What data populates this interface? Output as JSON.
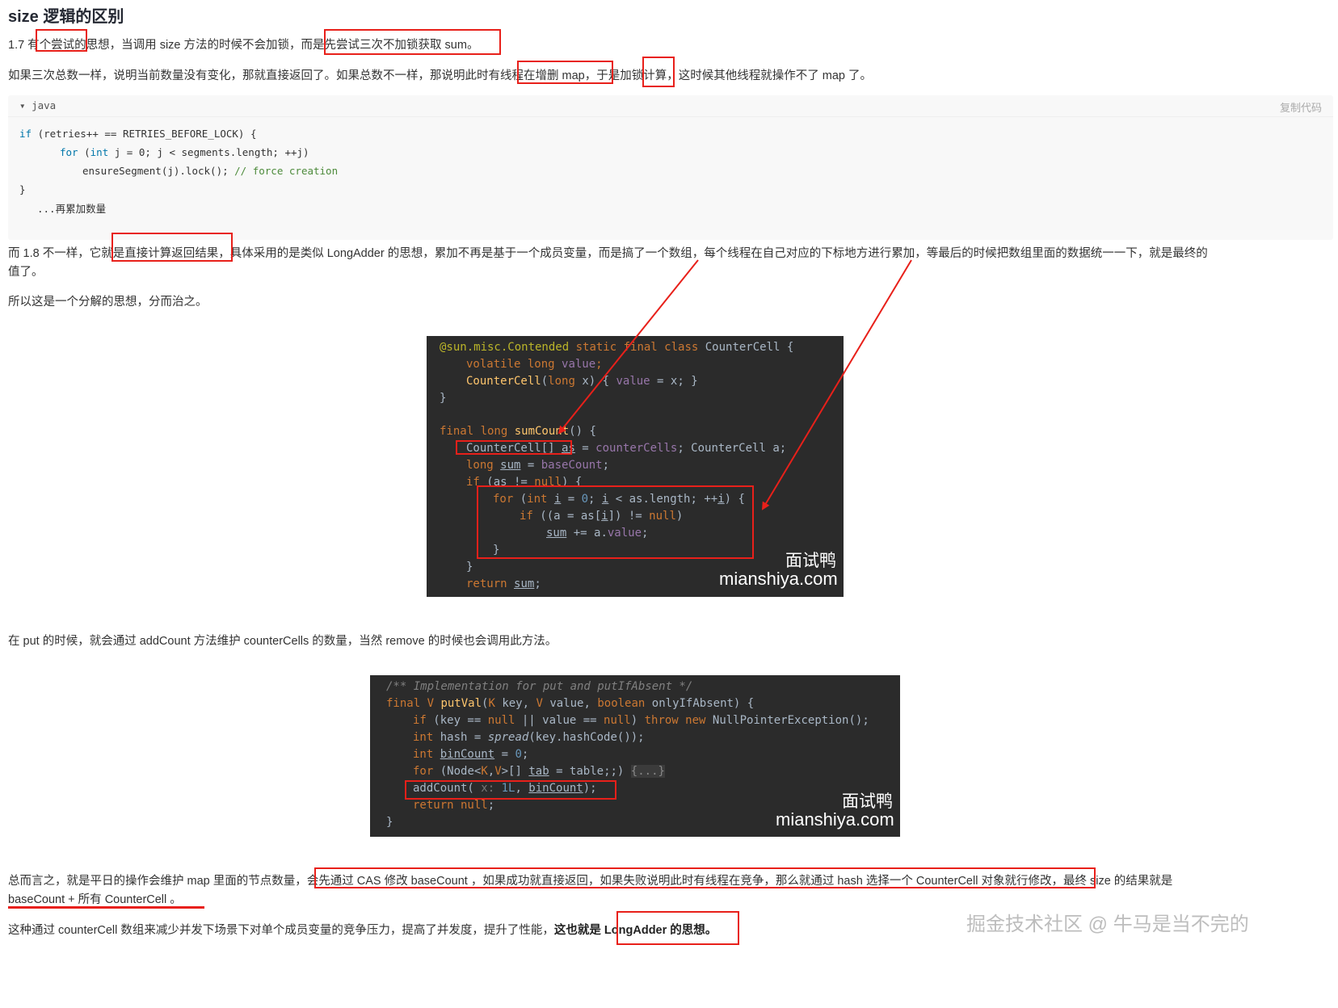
{
  "heading": "size 逻辑的区别",
  "p1": {
    "pre": "1.7 有",
    "hl1": "个尝试的",
    "mid": "思想，当调用 size 方法的时候不会加锁，而",
    "hl2": "是先尝试三次不加锁获取 sum。"
  },
  "p2": {
    "pre": "如果三次总数一样，说明当前数量没有变化，那就直接返回了。如果总数不一样，那说明此时有",
    "hl1": "线程在增删 map",
    "mid": "，于是",
    "hl2": "加锁",
    "post": "计算，这时候其他线程就操作不了 map 了。"
  },
  "code1": {
    "lang": "java",
    "copy_label": "复制代码",
    "line1_kw": "if",
    "line1_rest": " (retries++ == RETRIES_BEFORE_LOCK) {",
    "line2_kw1": "for",
    "line2_p1": " (",
    "line2_kw2": "int",
    "line2_rest": " j = 0; j < segments.length; ++j)",
    "line3_code": "ensureSegment(j).lock(); ",
    "line3_comment": "// force creation",
    "line4": "}",
    "line5": "...再累加数量"
  },
  "p3": {
    "pre": "而 1.8 不一样，它就",
    "hl": "是直接计算返回结果",
    "post": "，具体采用的是类似 LongAdder 的思想，累加不再是基于一个成员变量，而是搞了一个数组，每个线程在自己对应的下标地方进行累加，等最后的时候把数组里面的数据统一一下，就是最终的",
    "post2": "值了。"
  },
  "p4": "所以这是一个分解的思想，分而治之。",
  "img1": {
    "l1_ann": "@sun.misc.Contended",
    "l1_k": " static final class ",
    "l1_name": "CounterCell",
    "l1_b": " {",
    "l2_k": "volatile long ",
    "l2_v": "value",
    "l2_s": ";",
    "l3_f": "CounterCell",
    "l3_a": "(",
    "l3_k": "long ",
    "l3_b": "x) { ",
    "l3_v": "value",
    "l3_c": " = x; }",
    "l4": "}",
    "l5_k": "final long ",
    "l5_f": "sumCount",
    "l5_b": "() {",
    "l6_a": "CounterCell[] ",
    "l6_u": "as",
    "l6_b": " = ",
    "l6_v": "counterCells",
    "l6_c": "; CounterCell a;",
    "l7_k": "long ",
    "l7_u": "sum",
    "l7_b": " = ",
    "l7_v": "baseCount",
    "l7_c": ";",
    "l8_k": "if",
    "l8_b": " (",
    "l8_u": "as",
    "l8_c": " != ",
    "l8_k2": "null",
    "l8_d": ") {",
    "l9_k": "for",
    "l9_b": " (",
    "l9_k2": "int ",
    "l9_u": "i",
    "l9_c": " = ",
    "l9_n": "0",
    "l9_d": "; ",
    "l9_u2": "i",
    "l9_e": " < as.length; ++",
    "l9_u3": "i",
    "l9_f": ") {",
    "l10_k": "if",
    "l10_b": " ((a = as[",
    "l10_u": "i",
    "l10_c": "]) != ",
    "l10_k2": "null",
    "l10_d": ")",
    "l11_u": "sum",
    "l11_b": " += a.",
    "l11_v": "value",
    "l11_c": ";",
    "l12": "}",
    "l13": "}",
    "l14_k": "return ",
    "l14_u": "sum",
    "l14_b": ";",
    "wm1": "面试鸭",
    "wm2": "mianshiya.com"
  },
  "p5": "在 put 的时候，就会通过 addCount 方法维护 counterCells 的数量，当然 remove 的时候也会调用此方法。",
  "img2": {
    "l1": "/** Implementation for put and putIfAbsent */",
    "l2_k": "final ",
    "l2_g": "V ",
    "l2_f": "putVal",
    "l2_a": "(",
    "l2_g2": "K ",
    "l2_b": "key, ",
    "l2_g3": "V ",
    "l2_c": "value, ",
    "l2_k2": "boolean ",
    "l2_d": "onlyIfAbsent) {",
    "l3_k": "if",
    "l3_b": " (key == ",
    "l3_k2": "null",
    "l3_c": " || value == ",
    "l3_k3": "null",
    "l3_d": ") ",
    "l3_k4": "throw new ",
    "l3_e": "NullPointerException();",
    "l4_k": "int ",
    "l4_b": "hash = ",
    "l4_f": "spread",
    "l4_c": "(key.hashCode());",
    "l5_k": "int ",
    "l5_u": "binCount",
    "l5_b": " = ",
    "l5_n": "0",
    "l5_c": ";",
    "l6_k": "for",
    "l6_b": " (Node<",
    "l6_g": "K",
    "l6_c": ",",
    "l6_g2": "V",
    "l6_d": ">[] ",
    "l6_u": "tab",
    "l6_e": " = table;;) ",
    "l6_f": "{...}",
    "l7_a": "addCount(",
    "l7_h": " x: ",
    "l7_n": "1L",
    "l7_b": ", ",
    "l7_u": "binCount",
    "l7_c": ");",
    "l8_k": "return null",
    ";": ";",
    "l9": "}",
    "wm1": "面试鸭",
    "wm2": "mianshiya.com"
  },
  "p6": {
    "pre": "总而言之，就是平日的操作会维护 map 里面的节点数量，",
    "hl": "会先通过 CAS 修改 baseCount ，如果成功就直接返回，如果失败说明此时有线程在竞争，那么就通过 hash 选择一个 CounterCell 对象就行修改",
    "post": "，最终 size 的结果就是",
    "line2": "baseCount + 所有 CounterCell 。"
  },
  "p7": {
    "pre": "这种通过 counterCell 数组来减少并发下场景下对单个成员变量的竞争压力，提高了并发度，提升了性能，",
    "bold1": "这也就",
    "bold2": "是 LongAdder 的思想。"
  },
  "watermark": "掘金技术社区 @ 牛马是当不完的",
  "colors": {
    "highlight_box": "#e8201a",
    "code_bg_light": "#f8f8f8",
    "code_bg_dark": "#2b2b2b"
  }
}
